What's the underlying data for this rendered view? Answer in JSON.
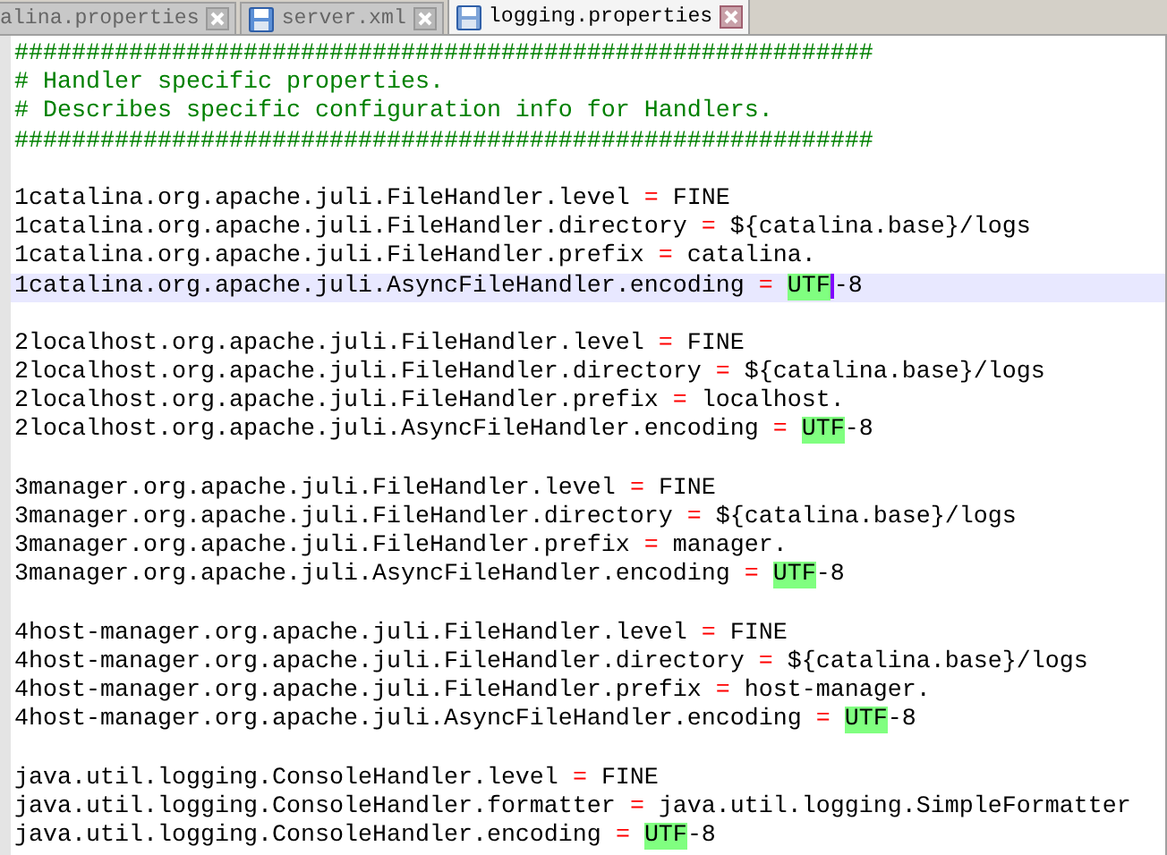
{
  "tabs": [
    {
      "label": "alina.properties",
      "selected": false,
      "icon": false
    },
    {
      "label": "server.xml",
      "selected": false,
      "icon": true
    },
    {
      "label": "logging.properties",
      "selected": true,
      "icon": true
    }
  ],
  "lines": [
    {
      "kind": "comment",
      "text": "############################################################"
    },
    {
      "kind": "comment",
      "text": "# Handler specific properties."
    },
    {
      "kind": "comment",
      "text": "# Describes specific configuration info for Handlers."
    },
    {
      "kind": "comment",
      "text": "############################################################"
    },
    {
      "kind": "blank"
    },
    {
      "kind": "property",
      "key": "1catalina.org.apache.juli.FileHandler.level",
      "operator": "=",
      "value": [
        {
          "text": "FINE",
          "highlighted": false
        }
      ],
      "selected": false
    },
    {
      "kind": "property",
      "key": "1catalina.org.apache.juli.FileHandler.directory",
      "operator": "=",
      "value": [
        {
          "text": "${catalina.base}/logs",
          "highlighted": false
        }
      ],
      "selected": false
    },
    {
      "kind": "property",
      "key": "1catalina.org.apache.juli.FileHandler.prefix",
      "operator": "=",
      "value": [
        {
          "text": "catalina.",
          "highlighted": false
        }
      ],
      "selected": false
    },
    {
      "kind": "property",
      "key": "1catalina.org.apache.juli.AsyncFileHandler.encoding",
      "operator": "=",
      "value": [
        {
          "text": "UTF",
          "highlighted": true
        },
        {
          "text": "-8",
          "highlighted": false
        }
      ],
      "selected": true
    },
    {
      "kind": "blank"
    },
    {
      "kind": "property",
      "key": "2localhost.org.apache.juli.FileHandler.level",
      "operator": "=",
      "value": [
        {
          "text": "FINE",
          "highlighted": false
        }
      ],
      "selected": false
    },
    {
      "kind": "property",
      "key": "2localhost.org.apache.juli.FileHandler.directory",
      "operator": "=",
      "value": [
        {
          "text": "${catalina.base}/logs",
          "highlighted": false
        }
      ],
      "selected": false
    },
    {
      "kind": "property",
      "key": "2localhost.org.apache.juli.FileHandler.prefix",
      "operator": "=",
      "value": [
        {
          "text": "localhost.",
          "highlighted": false
        }
      ],
      "selected": false
    },
    {
      "kind": "property",
      "key": "2localhost.org.apache.juli.AsyncFileHandler.encoding",
      "operator": "=",
      "value": [
        {
          "text": "UTF",
          "highlighted": true
        },
        {
          "text": "-8",
          "highlighted": false
        }
      ],
      "selected": false
    },
    {
      "kind": "blank"
    },
    {
      "kind": "property",
      "key": "3manager.org.apache.juli.FileHandler.level",
      "operator": "=",
      "value": [
        {
          "text": "FINE",
          "highlighted": false
        }
      ],
      "selected": false
    },
    {
      "kind": "property",
      "key": "3manager.org.apache.juli.FileHandler.directory",
      "operator": "=",
      "value": [
        {
          "text": "${catalina.base}/logs",
          "highlighted": false
        }
      ],
      "selected": false
    },
    {
      "kind": "property",
      "key": "3manager.org.apache.juli.FileHandler.prefix",
      "operator": "=",
      "value": [
        {
          "text": "manager.",
          "highlighted": false
        }
      ],
      "selected": false
    },
    {
      "kind": "property",
      "key": "3manager.org.apache.juli.AsyncFileHandler.encoding",
      "operator": "=",
      "value": [
        {
          "text": "UTF",
          "highlighted": true
        },
        {
          "text": "-8",
          "highlighted": false
        }
      ],
      "selected": false
    },
    {
      "kind": "blank"
    },
    {
      "kind": "property",
      "key": "4host-manager.org.apache.juli.FileHandler.level",
      "operator": "=",
      "value": [
        {
          "text": "FINE",
          "highlighted": false
        }
      ],
      "selected": false
    },
    {
      "kind": "property",
      "key": "4host-manager.org.apache.juli.FileHandler.directory",
      "operator": "=",
      "value": [
        {
          "text": "${catalina.base}/logs",
          "highlighted": false
        }
      ],
      "selected": false
    },
    {
      "kind": "property",
      "key": "4host-manager.org.apache.juli.FileHandler.prefix",
      "operator": "=",
      "value": [
        {
          "text": "host-manager.",
          "highlighted": false
        }
      ],
      "selected": false
    },
    {
      "kind": "property",
      "key": "4host-manager.org.apache.juli.AsyncFileHandler.encoding",
      "operator": "=",
      "value": [
        {
          "text": "UTF",
          "highlighted": true
        },
        {
          "text": "-8",
          "highlighted": false
        }
      ],
      "selected": false
    },
    {
      "kind": "blank"
    },
    {
      "kind": "property",
      "key": "java.util.logging.ConsoleHandler.level",
      "operator": "=",
      "value": [
        {
          "text": "FINE",
          "highlighted": false
        }
      ],
      "selected": false
    },
    {
      "kind": "property",
      "key": "java.util.logging.ConsoleHandler.formatter",
      "operator": "=",
      "value": [
        {
          "text": "java.util.logging.SimpleFormatter",
          "highlighted": false
        }
      ],
      "selected": false
    },
    {
      "kind": "property",
      "key": "java.util.logging.ConsoleHandler.encoding",
      "operator": "=",
      "value": [
        {
          "text": "UTF",
          "highlighted": true
        },
        {
          "text": "-8",
          "highlighted": false
        }
      ],
      "selected": false
    }
  ]
}
